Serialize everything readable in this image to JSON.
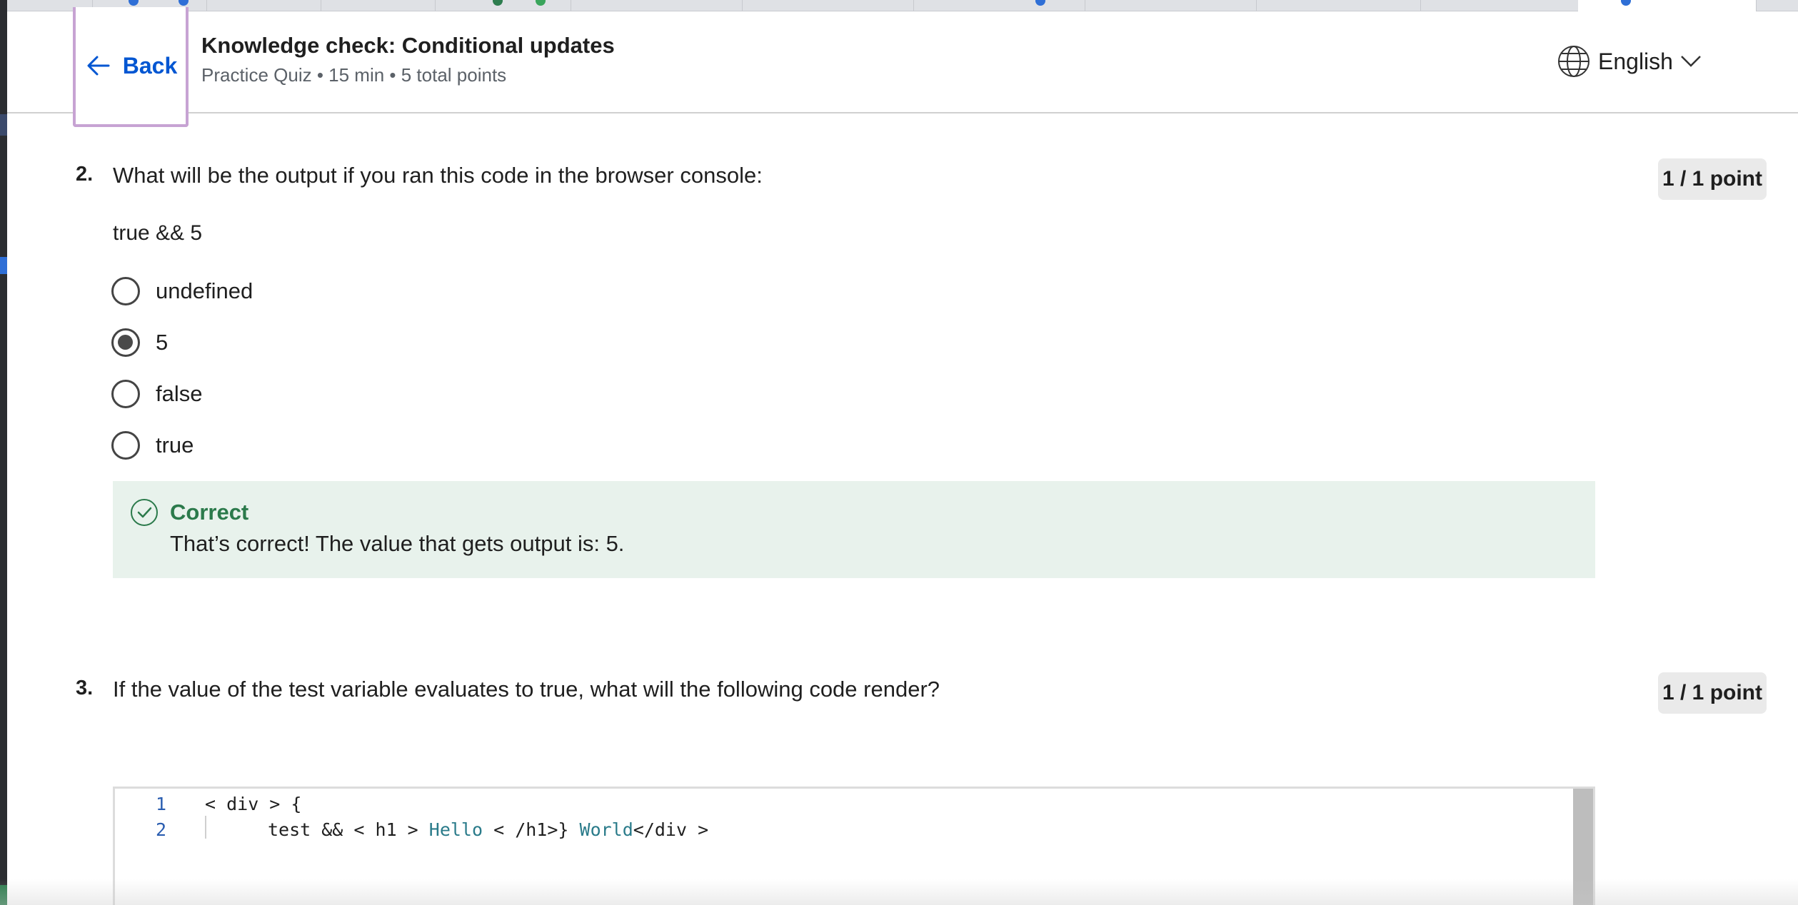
{
  "header": {
    "back_label": "Back",
    "title": "Knowledge check: Conditional updates",
    "subtitle": "Practice Quiz • 15 min • 5 total points",
    "language": "English"
  },
  "questions": [
    {
      "number": "2.",
      "prompt": "What will be the output if you ran this code in the browser console:",
      "points": "1 / 1 point",
      "snippet": "true && 5",
      "options": [
        {
          "label": "undefined",
          "selected": false
        },
        {
          "label": "5",
          "selected": true
        },
        {
          "label": "false",
          "selected": false
        },
        {
          "label": "true",
          "selected": false
        }
      ],
      "feedback": {
        "status": "Correct",
        "message": "That’s correct! The value that gets output is: 5."
      }
    },
    {
      "number": "3.",
      "prompt": "If the value of the test variable evaluates to true, what will the following code render?",
      "points": "1 / 1 point",
      "code": {
        "line_numbers": [
          "1",
          "2"
        ],
        "line1": "< div > {",
        "line2_a": "test && < h1 > ",
        "line2_hello": "Hello",
        "line2_b": " < /h1>} ",
        "line2_world": "World",
        "line2_c": "</div >"
      }
    }
  ],
  "icons": {
    "back": "arrow-left-icon",
    "language": "globe-icon",
    "language_caret": "chevron-down-icon",
    "feedback": "check-circle-icon"
  },
  "colors": {
    "accent": "#0056d2",
    "correct_text": "#2b7a4b",
    "correct_bg": "#e8f2ec",
    "focus_outline": "#c7a3d3"
  }
}
